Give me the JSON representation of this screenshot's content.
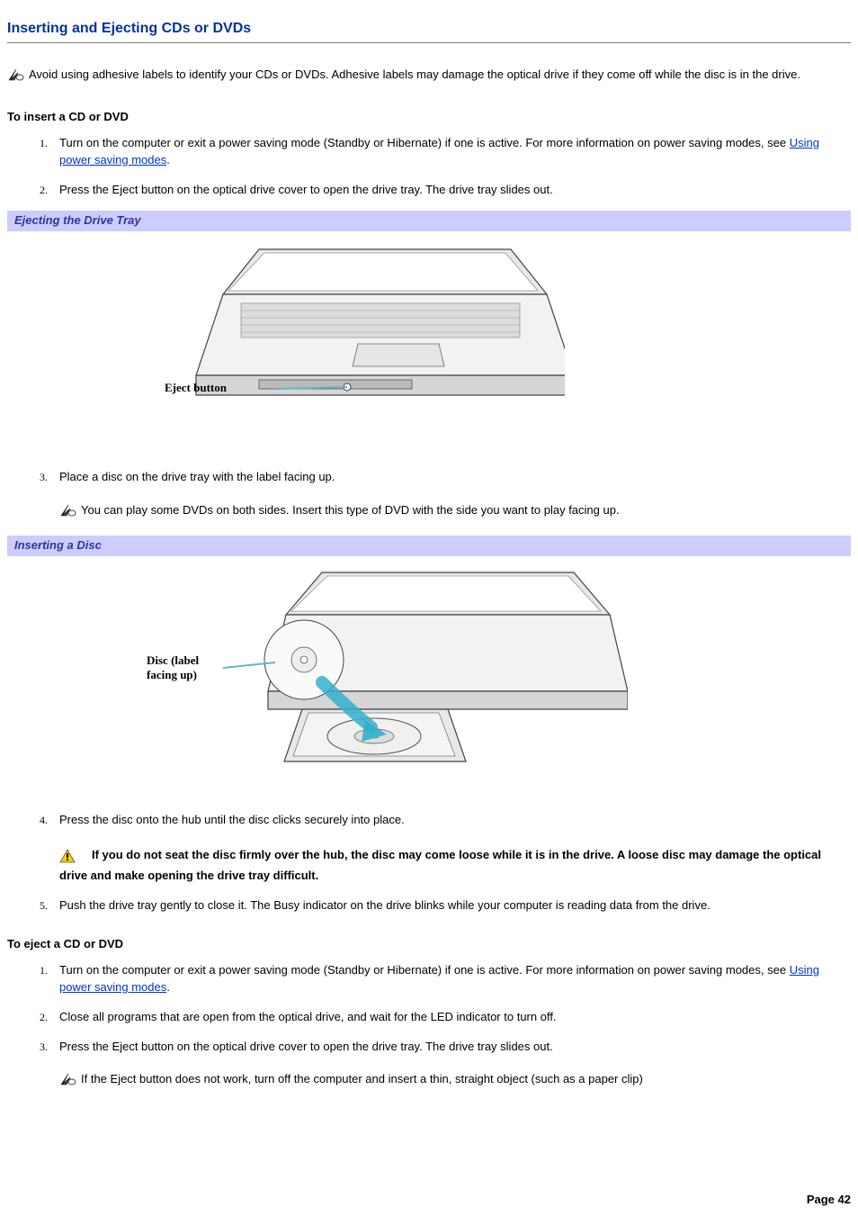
{
  "heading": "Inserting and Ejecting CDs or DVDs",
  "intro_note": "Avoid using adhesive labels to identify your CDs or DVDs. Adhesive labels may damage the optical drive if they come off while the disc is in the drive.",
  "section_insert_title": "To insert a CD or DVD",
  "insert_steps": {
    "s1_a": "Turn on the computer or exit a power saving mode (Standby or Hibernate) if one is active. For more information on power saving modes, see ",
    "s1_link": "Using power saving modes",
    "s1_b": ".",
    "s2": "Press the Eject button on the optical drive cover to open the drive tray. The drive tray slides out.",
    "s3": "Place a disc on the drive tray with the label facing up.",
    "s3_note": "You can play some DVDs on both sides. Insert this type of DVD with the side you want to play facing up.",
    "s4": "Press the disc onto the hub until the disc clicks securely into place.",
    "s4_warn": "If you do not seat the disc firmly over the hub, the disc may come loose while it is in the drive. A loose disc may damage the optical drive and make opening the drive tray difficult.",
    "s5": "Push the drive tray gently to close it. The Busy indicator on the drive blinks while your computer is reading data from the drive."
  },
  "caption_eject": "Ejecting the Drive Tray",
  "fig1_label": "Eject button",
  "caption_insert_disc": "Inserting a Disc",
  "fig2_label_1": "Disc (label",
  "fig2_label_2": "facing up)",
  "section_eject_title": "To eject a CD or DVD",
  "eject_steps": {
    "s1_a": "Turn on the computer or exit a power saving mode (Standby or Hibernate) if one is active. For more information on power saving modes, see ",
    "s1_link": "Using power saving modes",
    "s1_b": ".",
    "s2": "Close all programs that are open from the optical drive, and wait for the LED indicator to turn off.",
    "s3": "Press the Eject button on the optical drive cover to open the drive tray. The drive tray slides out.",
    "s3_note": "If the Eject button does not work, turn off the computer and insert a thin, straight object (such as a paper clip)"
  },
  "page_label": "Page 42"
}
